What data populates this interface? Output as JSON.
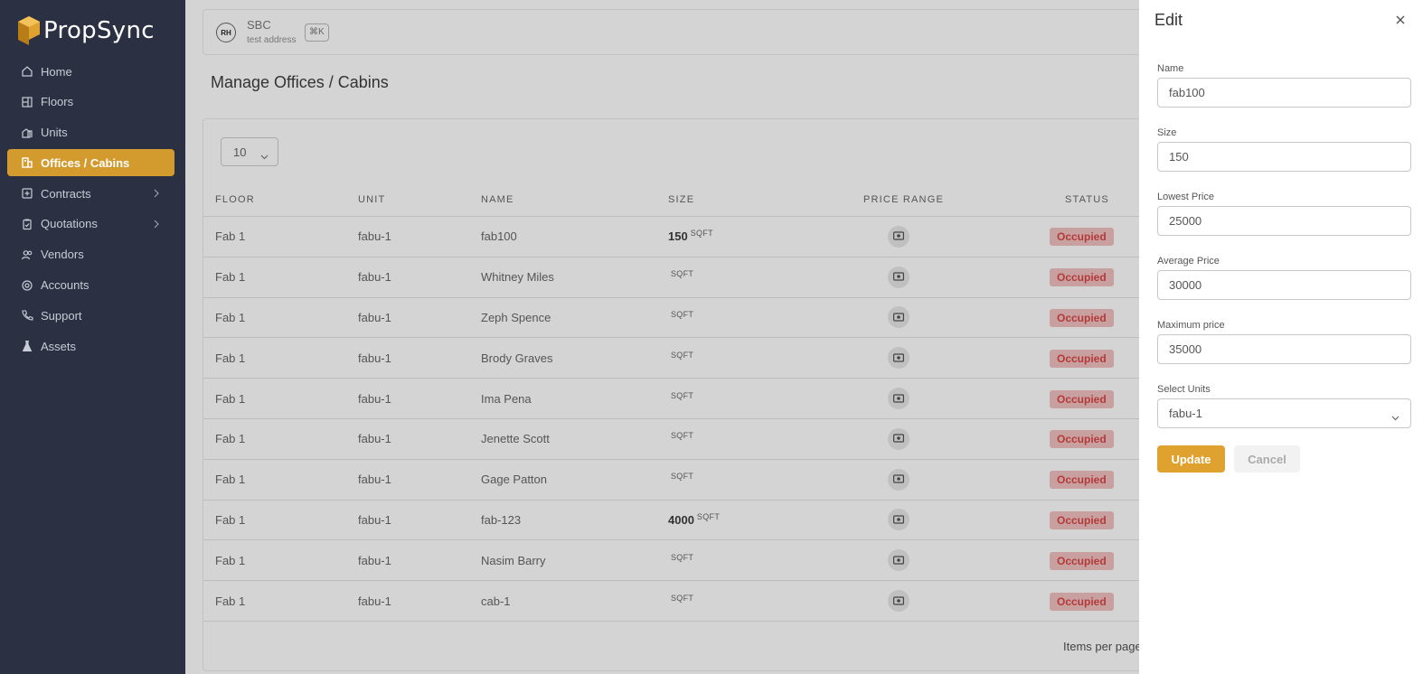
{
  "app": {
    "name": "PropSync"
  },
  "sidebar": {
    "items": [
      {
        "label": "Home",
        "icon": "home-icon"
      },
      {
        "label": "Floors",
        "icon": "floors-icon"
      },
      {
        "label": "Units",
        "icon": "units-icon"
      },
      {
        "label": "Offices / Cabins",
        "icon": "offices-icon",
        "active": true
      },
      {
        "label": "Contracts",
        "icon": "contracts-icon",
        "expandable": true
      },
      {
        "label": "Quotations",
        "icon": "quotations-icon",
        "expandable": true
      },
      {
        "label": "Vendors",
        "icon": "vendors-icon"
      },
      {
        "label": "Accounts",
        "icon": "accounts-icon"
      },
      {
        "label": "Support",
        "icon": "support-icon"
      },
      {
        "label": "Assets",
        "icon": "assets-icon"
      }
    ]
  },
  "header": {
    "company_logo_text": "RH",
    "company_name": "SBC",
    "company_address": "test address",
    "shortcut": "⌘K"
  },
  "page": {
    "title": "Manage Offices / Cabins"
  },
  "table": {
    "page_size": "10",
    "columns": [
      "FLOOR",
      "UNIT",
      "NAME",
      "SIZE",
      "PRICE RANGE",
      "STATUS"
    ],
    "rows": [
      {
        "floor": "Fab 1",
        "unit": "fabu-1",
        "name": "fab100",
        "size": "150",
        "unit_label": "SQFT",
        "status": "Occupied"
      },
      {
        "floor": "Fab 1",
        "unit": "fabu-1",
        "name": "Whitney Miles",
        "size": "",
        "unit_label": "SQFT",
        "status": "Occupied"
      },
      {
        "floor": "Fab 1",
        "unit": "fabu-1",
        "name": "Zeph Spence",
        "size": "",
        "unit_label": "SQFT",
        "status": "Occupied"
      },
      {
        "floor": "Fab 1",
        "unit": "fabu-1",
        "name": "Brody Graves",
        "size": "",
        "unit_label": "SQFT",
        "status": "Occupied"
      },
      {
        "floor": "Fab 1",
        "unit": "fabu-1",
        "name": "Ima Pena",
        "size": "",
        "unit_label": "SQFT",
        "status": "Occupied"
      },
      {
        "floor": "Fab 1",
        "unit": "fabu-1",
        "name": "Jenette Scott",
        "size": "",
        "unit_label": "SQFT",
        "status": "Occupied"
      },
      {
        "floor": "Fab 1",
        "unit": "fabu-1",
        "name": "Gage Patton",
        "size": "",
        "unit_label": "SQFT",
        "status": "Occupied"
      },
      {
        "floor": "Fab 1",
        "unit": "fabu-1",
        "name": "fab-123",
        "size": "4000",
        "unit_label": "SQFT",
        "status": "Occupied"
      },
      {
        "floor": "Fab 1",
        "unit": "fabu-1",
        "name": "Nasim Barry",
        "size": "",
        "unit_label": "SQFT",
        "status": "Occupied"
      },
      {
        "floor": "Fab 1",
        "unit": "fabu-1",
        "name": "cab-1",
        "size": "",
        "unit_label": "SQFT",
        "status": "Occupied"
      }
    ],
    "footer_text": "Items per page"
  },
  "drawer": {
    "title": "Edit",
    "fields": {
      "name": {
        "label": "Name",
        "value": "fab100"
      },
      "size": {
        "label": "Size",
        "value": "150"
      },
      "lowest_price": {
        "label": "Lowest Price",
        "value": "25000"
      },
      "average_price": {
        "label": "Average Price",
        "value": "30000"
      },
      "maximum_price": {
        "label": "Maximum price",
        "value": "35000"
      },
      "select_units": {
        "label": "Select Units",
        "value": "fabu-1"
      }
    },
    "update_label": "Update",
    "cancel_label": "Cancel"
  },
  "colors": {
    "sidebar_bg": "#2b3143",
    "accent": "#e0a22f",
    "status_occupied_text": "#b43a3a"
  }
}
